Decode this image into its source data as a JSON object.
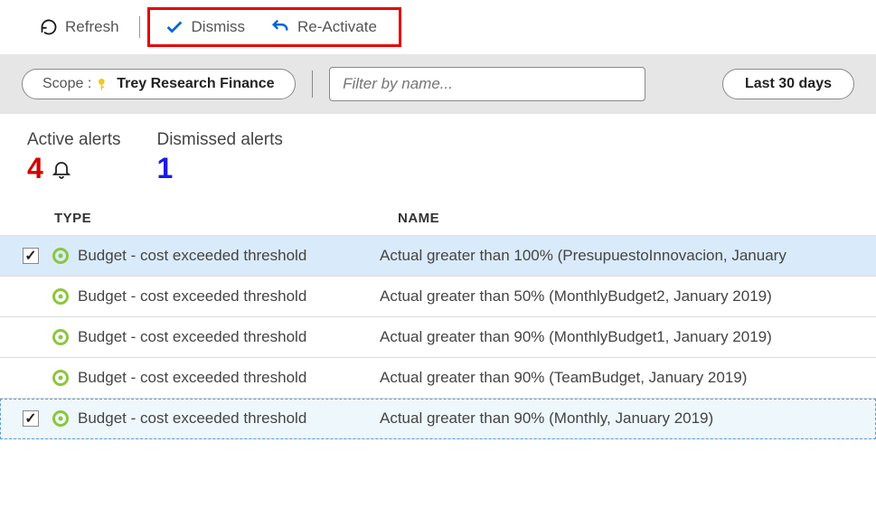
{
  "toolbar": {
    "refresh_label": "Refresh",
    "dismiss_label": "Dismiss",
    "reactivate_label": "Re-Activate"
  },
  "filter": {
    "scope_prefix": "Scope :",
    "scope_value": "Trey Research Finance",
    "filter_placeholder": "Filter by name...",
    "date_range": "Last 30 days"
  },
  "stats": {
    "active_label": "Active alerts",
    "active_count": "4",
    "dismissed_label": "Dismissed alerts",
    "dismissed_count": "1"
  },
  "columns": {
    "type": "TYPE",
    "name": "NAME"
  },
  "rows": [
    {
      "checked": true,
      "selected": true,
      "focused": false,
      "type": "Budget - cost exceeded threshold",
      "name": "Actual greater than 100% (PresupuestoInnovacion, January "
    },
    {
      "checked": false,
      "selected": false,
      "focused": false,
      "type": "Budget - cost exceeded threshold",
      "name": "Actual greater than 50% (MonthlyBudget2, January 2019)"
    },
    {
      "checked": false,
      "selected": false,
      "focused": false,
      "type": "Budget - cost exceeded threshold",
      "name": "Actual greater than 90% (MonthlyBudget1, January 2019)"
    },
    {
      "checked": false,
      "selected": false,
      "focused": false,
      "type": "Budget - cost exceeded threshold",
      "name": "Actual greater than 90% (TeamBudget, January 2019)"
    },
    {
      "checked": true,
      "selected": false,
      "focused": true,
      "type": "Budget - cost exceeded threshold",
      "name": "Actual greater than 90% (Monthly, January 2019)"
    }
  ]
}
